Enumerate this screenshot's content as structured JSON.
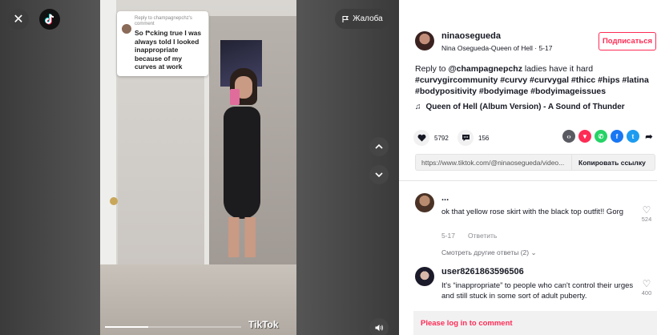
{
  "video": {
    "report_label": "Жалоба",
    "watermark": "TikTok",
    "progress": 0.32,
    "comment_card": {
      "reply_line_1": "Reply to champagnepchz's",
      "reply_line_2": "comment",
      "text": "So f*cking true I was always told I looked inappropriate because of my curves at work"
    }
  },
  "author": {
    "username": "ninaosegueda",
    "display_name": "Nina Osegueda-Queen of Hell",
    "date": "5-17",
    "follow_label": "Подписаться"
  },
  "description": {
    "prefix": "Reply to ",
    "mention": "@champagnepchz",
    "text": " ladies have it hard ",
    "hashtags": "#curvygircommunity #curvy #curvygal #thicc #hips #latina #bodypositivity #bodyimage #bodyimageissues"
  },
  "music": "Queen of Hell (Album Version) - A Sound of Thunder",
  "stats": {
    "likes": "5792",
    "comments": "156"
  },
  "link": {
    "url": "https://www.tiktok.com/@ninaosegueda/video...",
    "copy_label": "Копировать ссылку"
  },
  "comments": [
    {
      "username": "...",
      "text": "ok that yellow rose skirt with the black top outfit!! Gorg",
      "date": "5-17",
      "reply_label": "Ответить",
      "likes": "524"
    },
    {
      "username": "user8261863596506",
      "text": "It's “inappropriate” to people who can't control their urges and still stuck in some sort of adult puberty.",
      "likes": "400"
    }
  ],
  "view_more": "Смотреть другие ответы (2)",
  "login_prompt": "Please log in to comment",
  "colors": {
    "brand": "#fe2c55",
    "text": "#161823",
    "muted": "#8a8b91"
  }
}
